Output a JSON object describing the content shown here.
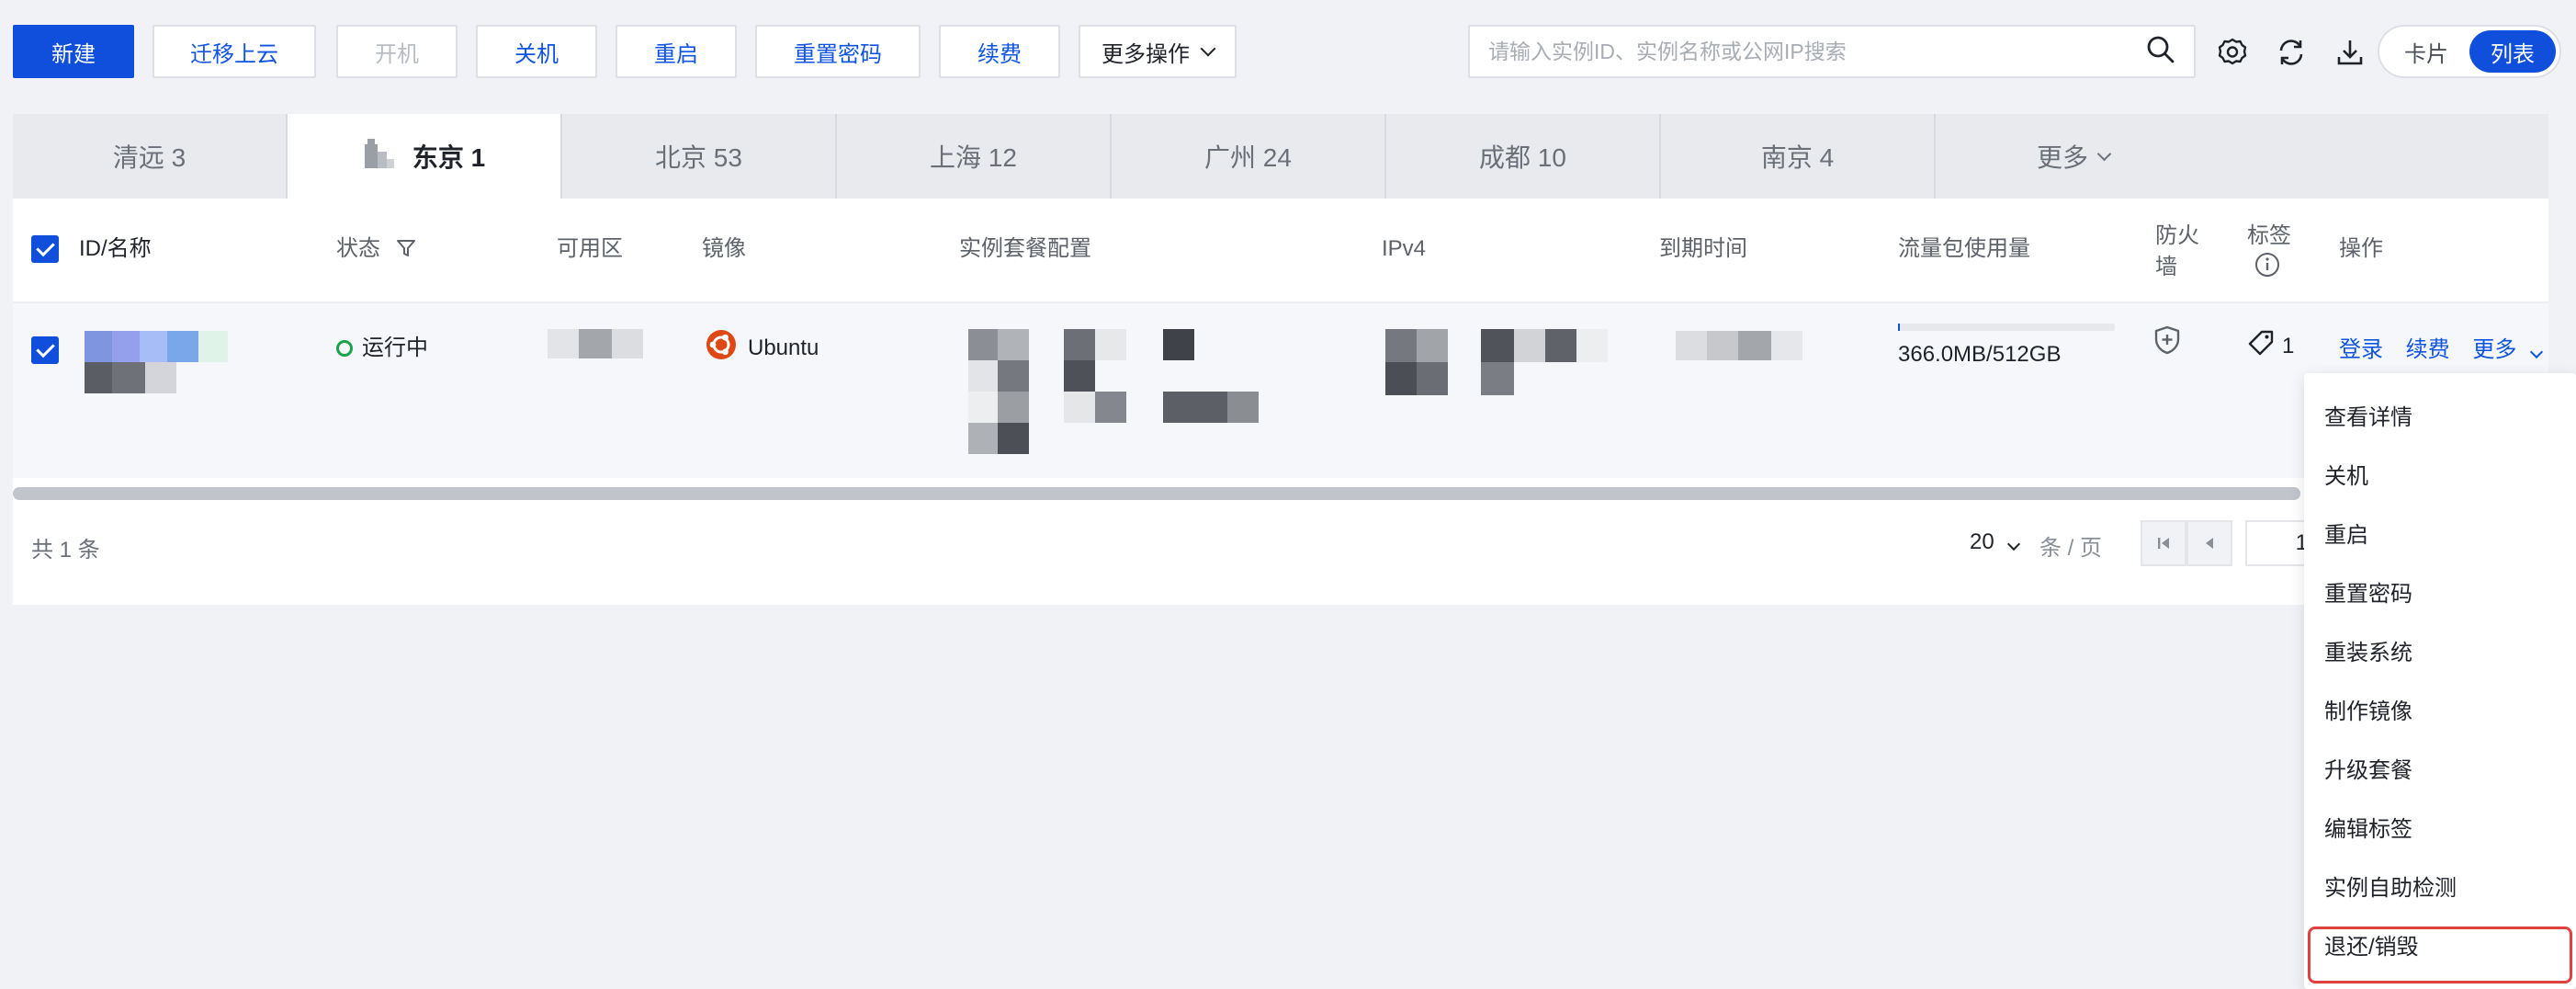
{
  "toolbar": {
    "new": "新建",
    "migrate": "迁移上云",
    "start": "开机",
    "shutdown": "关机",
    "restart": "重启",
    "reset_password": "重置密码",
    "renew": "续费",
    "more_actions": "更多操作",
    "search_placeholder": "请输入实例ID、实例名称或公网IP搜索",
    "view_card": "卡片",
    "view_list": "列表"
  },
  "tabs": [
    {
      "label": "清远 3"
    },
    {
      "label": "东京 1"
    },
    {
      "label": "北京 53"
    },
    {
      "label": "上海 12"
    },
    {
      "label": "广州 24"
    },
    {
      "label": "成都 10"
    },
    {
      "label": "南京 4"
    },
    {
      "label": "更多"
    }
  ],
  "active_tab": "东京 1",
  "table": {
    "headers": {
      "id_name": "ID/名称",
      "status": "状态",
      "zone": "可用区",
      "image": "镜像",
      "config": "实例套餐配置",
      "ipv4": "IPv4",
      "expire": "到期时间",
      "traffic": "流量包使用量",
      "firewall_1": "防火",
      "firewall_2": "墙",
      "tags": "标签",
      "actions": "操作"
    },
    "row": {
      "status": "运行中",
      "image": "Ubuntu",
      "traffic": "366.0MB/512GB",
      "traffic_used_fraction": 0.0007,
      "tag_count": "1",
      "action_login": "登录",
      "action_renew": "续费",
      "action_more": "更多"
    }
  },
  "footer": {
    "total": "共 1 条",
    "page_size": "20",
    "page_unit": "条 / 页",
    "page": "1"
  },
  "menu": {
    "items": [
      "查看详情",
      "关机",
      "重启",
      "重置密码",
      "重装系统",
      "制作镜像",
      "升级套餐",
      "编辑标签",
      "实例自助检测",
      "退还/销毁"
    ]
  },
  "colors": {
    "primary": "#0f4fdb",
    "running": "#1aa34a",
    "highlight": "#e0413e"
  }
}
